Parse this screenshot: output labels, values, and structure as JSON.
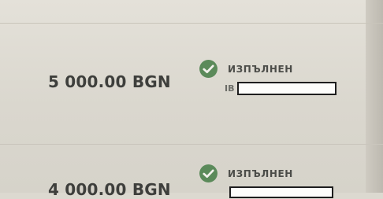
{
  "transactions": [
    {
      "amount": "5 000.00 BGN",
      "status": "ИЗПЪЛНЕН",
      "status_icon": "check-circle-icon",
      "reference_prefix": "IB"
    },
    {
      "amount": "4 000.00 BGN",
      "status": "ИЗПЪЛНЕН",
      "status_icon": "check-circle-icon",
      "reference_prefix": ""
    }
  ],
  "colors": {
    "success_green": "#5b8a5a",
    "text_dark": "#3e3f3c",
    "background": "#dcd9d0"
  }
}
